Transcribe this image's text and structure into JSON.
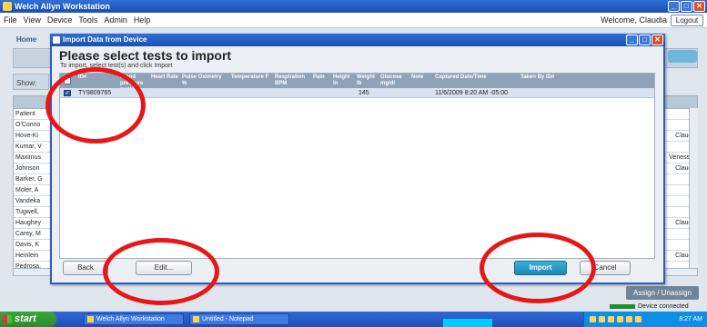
{
  "app": {
    "title": "Welch Allyn Workstation",
    "menu": [
      "File",
      "View",
      "Device",
      "Tools",
      "Admin",
      "Help"
    ],
    "welcome": "Welcome, Claudia",
    "logout_label": "Logout",
    "home_tab": "Home",
    "show_label": "Show:",
    "background_rows": [
      {
        "name": "Patient",
        "right": ""
      },
      {
        "name": "O'Conno",
        "right": ""
      },
      {
        "name": "Hove-Ki",
        "right": "Claudi"
      },
      {
        "name": "Kumar, V",
        "right": ""
      },
      {
        "name": "Maximus",
        "right": "Venessa"
      },
      {
        "name": "Johnson",
        "right": "Claudi"
      },
      {
        "name": "Barker, G",
        "right": ""
      },
      {
        "name": "Moler, A",
        "right": ""
      },
      {
        "name": "Vandeka",
        "right": ""
      },
      {
        "name": "Tugwell,",
        "right": ""
      },
      {
        "name": "Haughey",
        "right": "Claudi"
      },
      {
        "name": "Carey, M",
        "right": ""
      },
      {
        "name": "Davis, K",
        "right": ""
      },
      {
        "name": "Heinlein",
        "right": "Claudi"
      },
      {
        "name": "Pedrosa,",
        "right": ""
      }
    ],
    "assign_label": "Assign / Unassign",
    "device_status": "Device connected",
    "accent": "#2f6fd6"
  },
  "dialog": {
    "title": "Import Data from Device",
    "heading": "Please select tests to import",
    "subtitle": "To import, select test(s) and click Import",
    "columns": [
      "ID#",
      "Blood pressure mmHg",
      "Heart Rate",
      "Pulse Oximetry %",
      "Temperature F",
      "Respiration BPM",
      "Pain",
      "Height in",
      "Weight lb",
      "Glucose mg/dl",
      "Note",
      "Captured Date/Time",
      "Taken By ID#"
    ],
    "rows": [
      {
        "selected": true,
        "id": "TY9809765",
        "weight": "145",
        "captured": "11/6/2009 8:20 AM -05:00"
      }
    ],
    "buttons": {
      "back": "Back",
      "edit": "Edit...",
      "import": "Import",
      "cancel": "Cancel"
    }
  },
  "taskbar": {
    "start": "start",
    "items": [
      "Welch Allyn Workstation",
      "Untitled - Notepad"
    ],
    "clock": "8:27 AM"
  }
}
